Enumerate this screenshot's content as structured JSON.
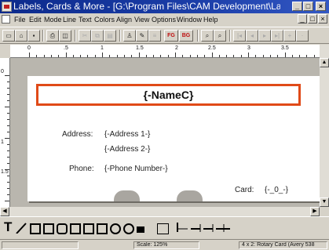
{
  "window": {
    "title": "Labels, Cards & More - [G:\\Program Files\\CAM Development\\Labels Ca...",
    "controls": {
      "minimize": "_",
      "maximize": "□",
      "close": "×"
    }
  },
  "menu": {
    "items": [
      "File",
      "Edit",
      "Mode",
      "Line",
      "Text",
      "Colors",
      "Align",
      "View",
      "Options",
      "Window",
      "Help"
    ]
  },
  "toolbar": {
    "fg_label": "FG",
    "bg_label": "BG"
  },
  "ruler": {
    "labels": [
      "0",
      ".5",
      "1",
      "1.5",
      "2",
      "2.5",
      "3",
      "3.5"
    ],
    "vlabels": [
      "0",
      "1",
      "1.5"
    ]
  },
  "card": {
    "name_field": "{-NameC}",
    "address_label": "Address:",
    "address1": "{-Address 1-}",
    "address2": "{-Address 2-}",
    "phone_label": "Phone:",
    "phone_value": "{-Phone Number-}",
    "card_label": "Card:",
    "card_value": "{-_0_-}"
  },
  "tools": {
    "text_tool": "T"
  },
  "status": {
    "scale": "Scale: 125%",
    "card_type": "4 x 2: Rotary Card (Avery 538"
  },
  "colors": {
    "titlebar": "#0c2a8c",
    "name_border": "#e04a18",
    "card_bg": "#ffffff"
  }
}
